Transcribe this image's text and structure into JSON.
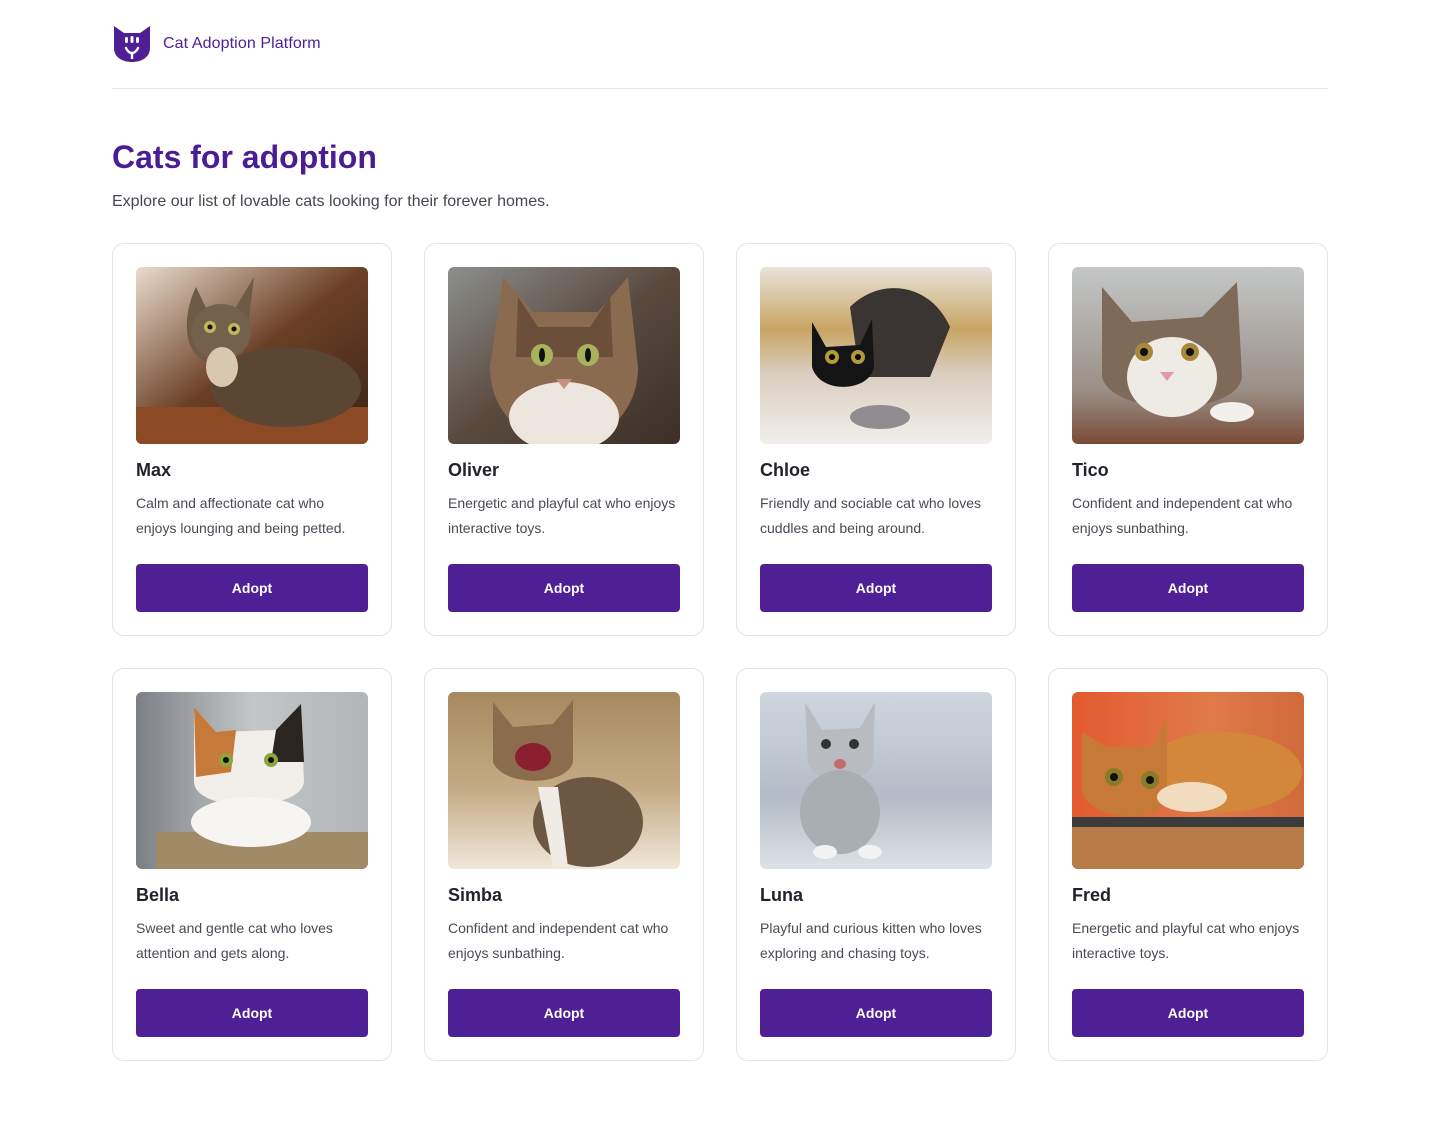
{
  "header": {
    "brand": "Cat Adoption Platform",
    "logo_icon": "cat-face-icon",
    "accent_color": "#4f1f96"
  },
  "main": {
    "title": "Cats for adoption",
    "subtitle": "Explore our list of lovable cats looking for their forever homes."
  },
  "cats": [
    {
      "name": "Max",
      "description": "Calm and affectionate cat who enjoys lounging and being petted.",
      "button": "Adopt",
      "palette": [
        "#5a3b28",
        "#8a6a4c",
        "#3a2a1e",
        "#c9a27a"
      ]
    },
    {
      "name": "Oliver",
      "description": "Energetic and playful cat who enjoys interactive toys.",
      "button": "Adopt",
      "palette": [
        "#6e5b4c",
        "#a48366",
        "#2f2823",
        "#e7e2dc"
      ]
    },
    {
      "name": "Chloe",
      "description": "Friendly and sociable cat who loves cuddles and being around.",
      "button": "Adopt",
      "palette": [
        "#c7a462",
        "#e6dfd6",
        "#141414",
        "#8a6c46"
      ]
    },
    {
      "name": "Tico",
      "description": "Confident and independent cat who enjoys sunbathing.",
      "button": "Adopt",
      "palette": [
        "#9aa0a3",
        "#7c6a57",
        "#d8d2ca",
        "#5a4a3e"
      ]
    },
    {
      "name": "Bella",
      "description": "Sweet and gentle cat who loves attention and gets along.",
      "button": "Adopt",
      "palette": [
        "#b9bdc0",
        "#f4f1ec",
        "#c47a3a",
        "#2a2520"
      ]
    },
    {
      "name": "Simba",
      "description": "Confident and independent cat who enjoys sunbathing.",
      "button": "Adopt",
      "palette": [
        "#8e6a46",
        "#c9b08d",
        "#4b3b2b",
        "#e9dccb"
      ]
    },
    {
      "name": "Luna",
      "description": "Playful and curious kitten who loves exploring and chasing toys.",
      "button": "Adopt",
      "palette": [
        "#b8c2cc",
        "#d9dee4",
        "#8d949b",
        "#f2f3f5"
      ]
    },
    {
      "name": "Fred",
      "description": "Energetic and playful cat who enjoys interactive toys.",
      "button": "Adopt",
      "palette": [
        "#e0673d",
        "#d28b3c",
        "#f0d2a8",
        "#6e4a2a"
      ]
    }
  ]
}
